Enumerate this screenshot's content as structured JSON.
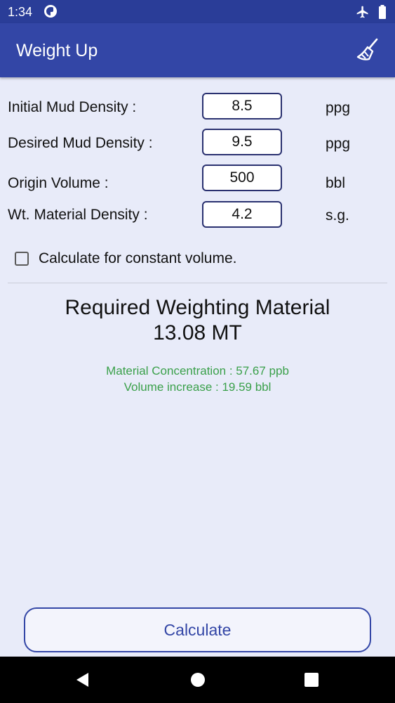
{
  "status_bar": {
    "time": "1:34",
    "icons": [
      "app-indicator-icon",
      "airplane-icon",
      "battery-icon"
    ]
  },
  "app_bar": {
    "title": "Weight Up",
    "action_icon": "broom-icon"
  },
  "fields": [
    {
      "label": "Initial Mud Density :",
      "value": "8.5",
      "unit": "ppg"
    },
    {
      "label": "Desired Mud Density :",
      "value": "9.5",
      "unit": "ppg"
    },
    {
      "label": "Origin Volume :",
      "value": "500",
      "unit": "bbl"
    },
    {
      "label": "Wt. Material Density :",
      "value": "4.2",
      "unit": "s.g."
    }
  ],
  "constant_volume": {
    "label": "Calculate for constant volume.",
    "checked": false
  },
  "result": {
    "title": "Required Weighting Material",
    "value": "13.08 MT",
    "concentration": "Material Concentration : 57.67 ppb",
    "volume_increase": "Volume increase : 19.59 bbl"
  },
  "calculate_label": "Calculate",
  "colors": {
    "status_bar": "#2a3d98",
    "app_bar": "#3346a6",
    "background": "#e8ebf9",
    "accent_green": "#3aa04a",
    "button_text": "#3346a6"
  }
}
